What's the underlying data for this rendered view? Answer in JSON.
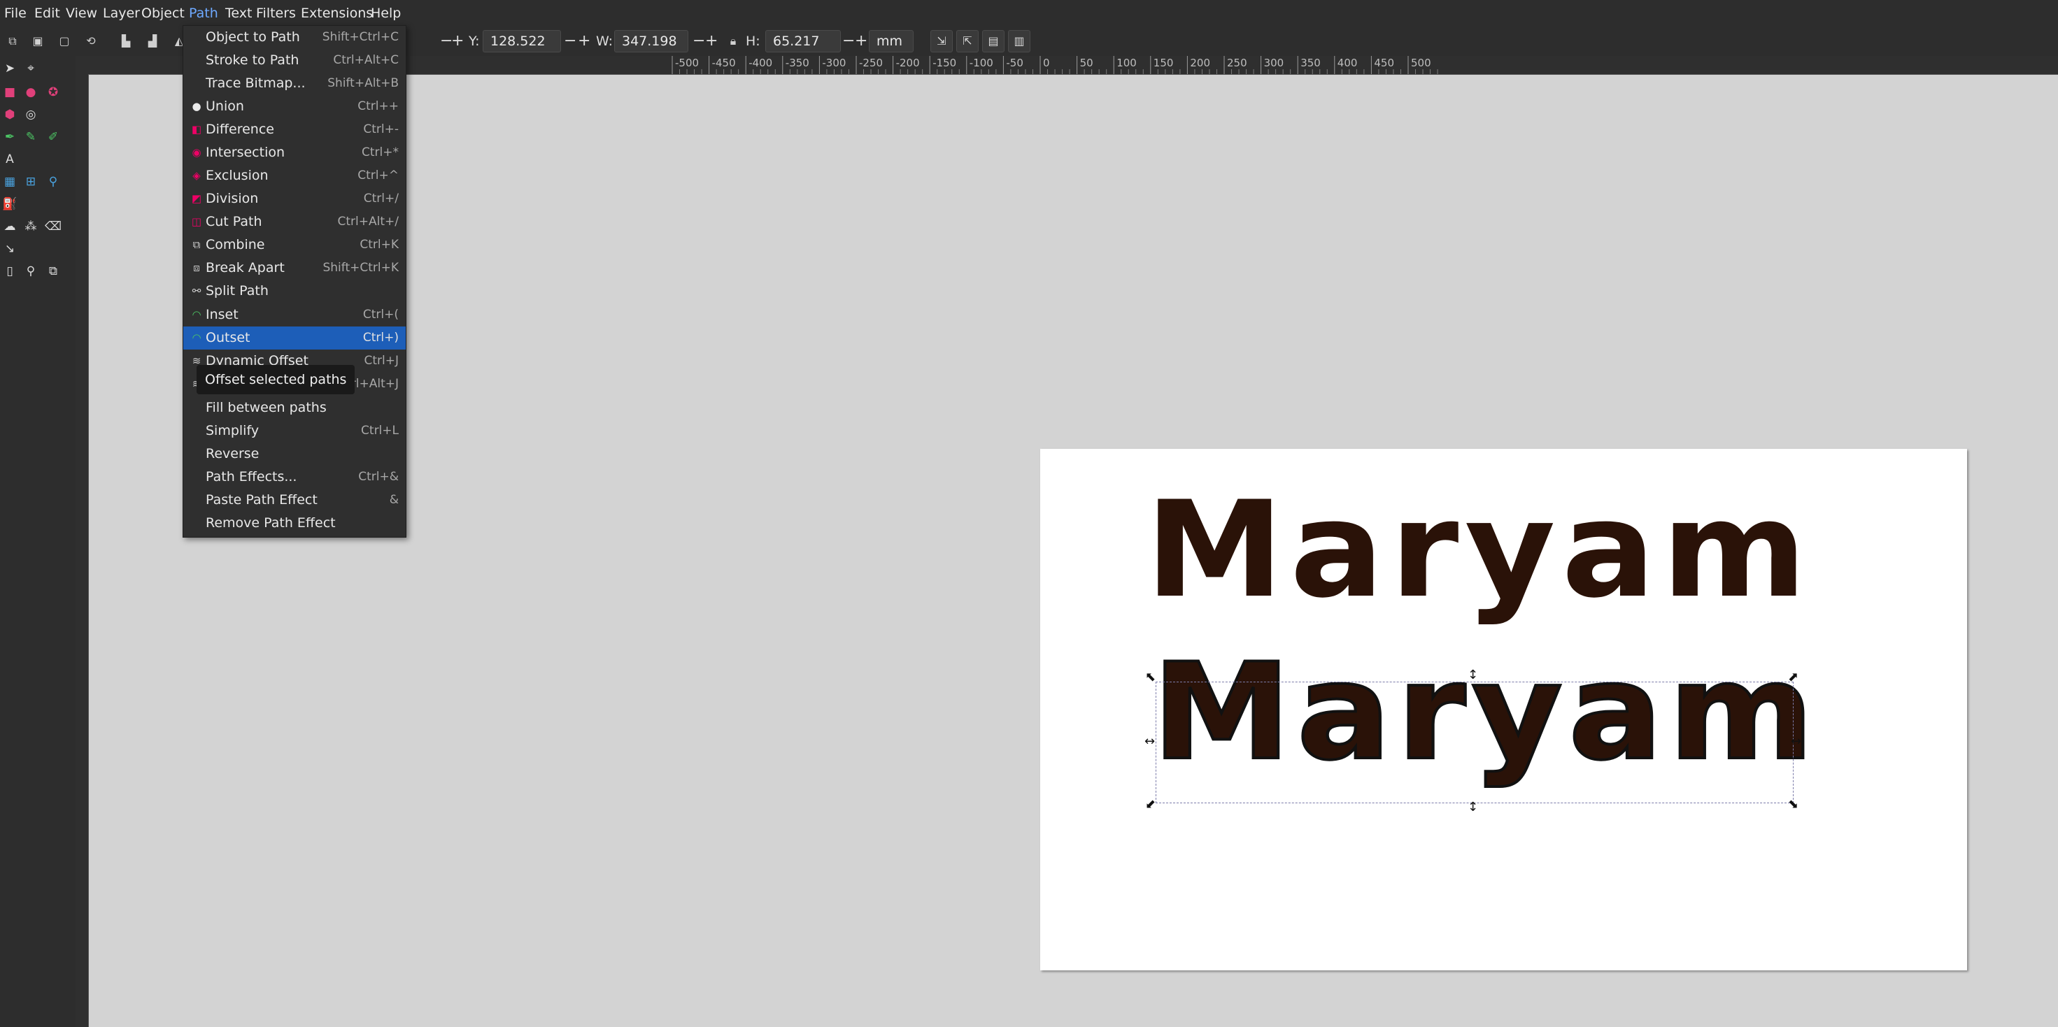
{
  "menubar": {
    "items": [
      "File",
      "Edit",
      "View",
      "Layer",
      "Object",
      "Path",
      "Text",
      "Filters",
      "Extensions",
      "Help"
    ],
    "active": "Path"
  },
  "toolbar": {
    "y_label": "Y:",
    "y_value": "128.522",
    "w_label": "W:",
    "w_value": "347.198",
    "h_label": "H:",
    "h_value": "65.217",
    "unit": "mm"
  },
  "ruler": {
    "ticks": [
      "-500",
      "-450",
      "-400",
      "-350",
      "-300",
      "-250",
      "-200",
      "-150",
      "-100",
      "-50",
      "0",
      "50",
      "100",
      "150",
      "200",
      "250",
      "300",
      "350",
      "400",
      "450",
      "500"
    ]
  },
  "path_menu": {
    "items": [
      {
        "label": "Object to Path",
        "shortcut": "Shift+Ctrl+C",
        "icon": ""
      },
      {
        "label": "Stroke to Path",
        "shortcut": "Ctrl+Alt+C",
        "icon": ""
      },
      {
        "label": "Trace Bitmap...",
        "shortcut": "Shift+Alt+B",
        "icon": ""
      },
      {
        "label": "Union",
        "shortcut": "Ctrl++",
        "icon": "union-icon"
      },
      {
        "label": "Difference",
        "shortcut": "Ctrl+-",
        "icon": "difference-icon"
      },
      {
        "label": "Intersection",
        "shortcut": "Ctrl+*",
        "icon": "intersection-icon"
      },
      {
        "label": "Exclusion",
        "shortcut": "Ctrl+^",
        "icon": "exclusion-icon"
      },
      {
        "label": "Division",
        "shortcut": "Ctrl+/",
        "icon": "division-icon"
      },
      {
        "label": "Cut Path",
        "shortcut": "Ctrl+Alt+/",
        "icon": "cut-path-icon"
      },
      {
        "label": "Combine",
        "shortcut": "Ctrl+K",
        "icon": "combine-icon"
      },
      {
        "label": "Break Apart",
        "shortcut": "Shift+Ctrl+K",
        "icon": "break-apart-icon"
      },
      {
        "label": "Split Path",
        "shortcut": "",
        "icon": "split-path-icon"
      },
      {
        "label": "Inset",
        "shortcut": "Ctrl+(",
        "icon": "inset-icon"
      },
      {
        "label": "Outset",
        "shortcut": "Ctrl+)",
        "icon": "outset-icon"
      },
      {
        "label": "Dynamic Offset",
        "shortcut": "Ctrl+J",
        "icon": "dynamic-offset-icon"
      },
      {
        "label": "",
        "shortcut": "Ctrl+Alt+J",
        "icon": "linked-offset-icon"
      },
      {
        "label": "Fill between paths",
        "shortcut": "",
        "icon": ""
      },
      {
        "label": "Simplify",
        "shortcut": "Ctrl+L",
        "icon": ""
      },
      {
        "label": "Reverse",
        "shortcut": "",
        "icon": ""
      },
      {
        "label": "Path Effects...",
        "shortcut": "Ctrl+&",
        "icon": ""
      },
      {
        "label": "Paste Path Effect",
        "shortcut": "&",
        "icon": ""
      },
      {
        "label": "Remove Path Effect",
        "shortcut": "",
        "icon": ""
      }
    ],
    "highlighted": "Outset"
  },
  "tooltip": "Offset selected paths",
  "canvas": {
    "text_top": "Maryam",
    "text_bottom": "Maryam"
  },
  "colors": {
    "text_fill": "#2a1208",
    "highlight": "#1d5eb8",
    "chrome": "#2d2d2d"
  }
}
